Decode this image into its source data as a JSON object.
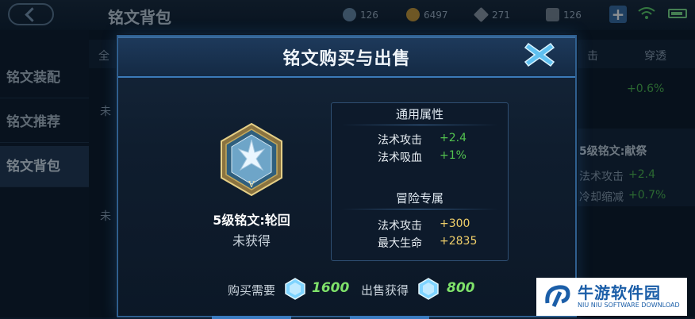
{
  "topbar": {
    "title": "铭文背包",
    "resources": [
      {
        "icon": "gem-icon",
        "value": "126"
      },
      {
        "icon": "gold-coin-icon",
        "value": "6497"
      },
      {
        "icon": "diamond-icon",
        "value": "271"
      },
      {
        "icon": "rune-shard-icon",
        "value": "126"
      }
    ]
  },
  "sidebar": {
    "items": [
      {
        "label": "铭文装配"
      },
      {
        "label": "铭文推荐"
      },
      {
        "label": "铭文背包"
      }
    ]
  },
  "background": {
    "filter_left": "全",
    "filter_mid": "击",
    "filter_right": "穿透",
    "row1_text": "未",
    "row1_value": "+0.6%",
    "card_title": "5级铭文:献祭",
    "card_attr1_label": "法术攻击",
    "card_attr1_value": "+2.4",
    "card_attr2_label": "冷却缩减",
    "card_attr2_value": "+0.7%",
    "row2_text": "未"
  },
  "dialog": {
    "title": "铭文购买与出售",
    "rune_name": "5级铭文:轮回",
    "rune_status": "未获得",
    "general_heading": "通用属性",
    "general_attrs": [
      {
        "label": "法术攻击",
        "value": "+2.4"
      },
      {
        "label": "法术吸血",
        "value": "+1%"
      }
    ],
    "adventure_heading": "冒险专属",
    "adventure_attrs": [
      {
        "label": "法术攻击",
        "value": "+300"
      },
      {
        "label": "最大生命",
        "value": "+2835"
      }
    ],
    "buy_label": "购买需要",
    "buy_value": "1600",
    "sell_label": "出售获得",
    "sell_value": "800"
  },
  "watermark": {
    "text": "牛游软件园",
    "sub": "NIU NIU SOFTWARE DOWNLOAD"
  },
  "colors": {
    "accent": "#3b7ab8",
    "positive": "#53c34f",
    "adventure": "#f0cf6a",
    "price": "#7fe26a"
  }
}
